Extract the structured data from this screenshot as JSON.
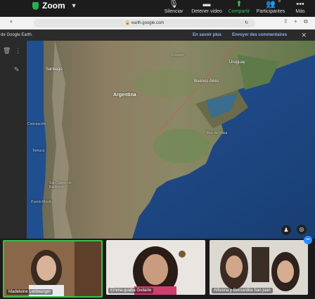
{
  "zoom": {
    "title": "Zoom",
    "controls": {
      "mute": "Silenciar",
      "stop_video": "Detener video",
      "share": "Compartir",
      "participants": "Participantes",
      "participants_count": "5",
      "more": "Más"
    }
  },
  "browser": {
    "url": "earth.google.com"
  },
  "banner": {
    "text": "de Google Earth.",
    "learn_more": "En savoir plus",
    "feedback": "Envoyer des commentaires"
  },
  "map": {
    "labels": {
      "santiago": "Santiago",
      "argentina": "Argentina",
      "rosario": "Rosario",
      "uruguay": "Uruguay",
      "buenos_aires": "Buenos Aires",
      "concepcion": "Concepción",
      "temuco": "Temuco",
      "san_carlos": "San Carlos de Bariloche",
      "puerto_montt": "Puerto Montt",
      "mar_del_plata": "Mar del Plata"
    }
  },
  "participants": [
    {
      "name": "Madeleine Leidwanger"
    },
    {
      "name": "Emma guaba Guilarte"
    },
    {
      "name": "Alfosina y Bernardita San juan"
    }
  ],
  "colors": {
    "zoom_green": "#23b14d",
    "share_green": "#34c35a",
    "active_border": "#37c04a",
    "link_blue": "#8ab4f8"
  }
}
